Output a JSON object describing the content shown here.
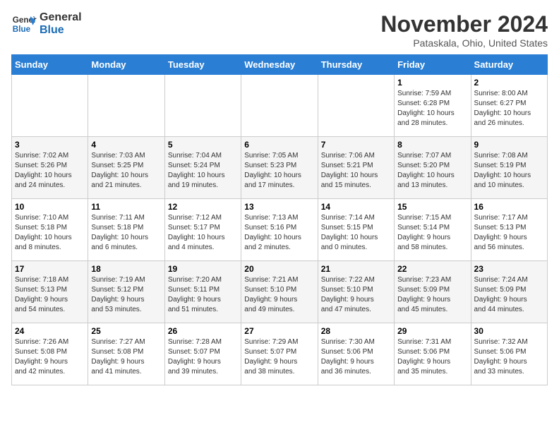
{
  "header": {
    "logo_line1": "General",
    "logo_line2": "Blue",
    "month_title": "November 2024",
    "location": "Pataskala, Ohio, United States"
  },
  "weekdays": [
    "Sunday",
    "Monday",
    "Tuesday",
    "Wednesday",
    "Thursday",
    "Friday",
    "Saturday"
  ],
  "weeks": [
    [
      {
        "day": "",
        "info": ""
      },
      {
        "day": "",
        "info": ""
      },
      {
        "day": "",
        "info": ""
      },
      {
        "day": "",
        "info": ""
      },
      {
        "day": "",
        "info": ""
      },
      {
        "day": "1",
        "info": "Sunrise: 7:59 AM\nSunset: 6:28 PM\nDaylight: 10 hours\nand 28 minutes."
      },
      {
        "day": "2",
        "info": "Sunrise: 8:00 AM\nSunset: 6:27 PM\nDaylight: 10 hours\nand 26 minutes."
      }
    ],
    [
      {
        "day": "3",
        "info": "Sunrise: 7:02 AM\nSunset: 5:26 PM\nDaylight: 10 hours\nand 24 minutes."
      },
      {
        "day": "4",
        "info": "Sunrise: 7:03 AM\nSunset: 5:25 PM\nDaylight: 10 hours\nand 21 minutes."
      },
      {
        "day": "5",
        "info": "Sunrise: 7:04 AM\nSunset: 5:24 PM\nDaylight: 10 hours\nand 19 minutes."
      },
      {
        "day": "6",
        "info": "Sunrise: 7:05 AM\nSunset: 5:23 PM\nDaylight: 10 hours\nand 17 minutes."
      },
      {
        "day": "7",
        "info": "Sunrise: 7:06 AM\nSunset: 5:21 PM\nDaylight: 10 hours\nand 15 minutes."
      },
      {
        "day": "8",
        "info": "Sunrise: 7:07 AM\nSunset: 5:20 PM\nDaylight: 10 hours\nand 13 minutes."
      },
      {
        "day": "9",
        "info": "Sunrise: 7:08 AM\nSunset: 5:19 PM\nDaylight: 10 hours\nand 10 minutes."
      }
    ],
    [
      {
        "day": "10",
        "info": "Sunrise: 7:10 AM\nSunset: 5:18 PM\nDaylight: 10 hours\nand 8 minutes."
      },
      {
        "day": "11",
        "info": "Sunrise: 7:11 AM\nSunset: 5:18 PM\nDaylight: 10 hours\nand 6 minutes."
      },
      {
        "day": "12",
        "info": "Sunrise: 7:12 AM\nSunset: 5:17 PM\nDaylight: 10 hours\nand 4 minutes."
      },
      {
        "day": "13",
        "info": "Sunrise: 7:13 AM\nSunset: 5:16 PM\nDaylight: 10 hours\nand 2 minutes."
      },
      {
        "day": "14",
        "info": "Sunrise: 7:14 AM\nSunset: 5:15 PM\nDaylight: 10 hours\nand 0 minutes."
      },
      {
        "day": "15",
        "info": "Sunrise: 7:15 AM\nSunset: 5:14 PM\nDaylight: 9 hours\nand 58 minutes."
      },
      {
        "day": "16",
        "info": "Sunrise: 7:17 AM\nSunset: 5:13 PM\nDaylight: 9 hours\nand 56 minutes."
      }
    ],
    [
      {
        "day": "17",
        "info": "Sunrise: 7:18 AM\nSunset: 5:13 PM\nDaylight: 9 hours\nand 54 minutes."
      },
      {
        "day": "18",
        "info": "Sunrise: 7:19 AM\nSunset: 5:12 PM\nDaylight: 9 hours\nand 53 minutes."
      },
      {
        "day": "19",
        "info": "Sunrise: 7:20 AM\nSunset: 5:11 PM\nDaylight: 9 hours\nand 51 minutes."
      },
      {
        "day": "20",
        "info": "Sunrise: 7:21 AM\nSunset: 5:10 PM\nDaylight: 9 hours\nand 49 minutes."
      },
      {
        "day": "21",
        "info": "Sunrise: 7:22 AM\nSunset: 5:10 PM\nDaylight: 9 hours\nand 47 minutes."
      },
      {
        "day": "22",
        "info": "Sunrise: 7:23 AM\nSunset: 5:09 PM\nDaylight: 9 hours\nand 45 minutes."
      },
      {
        "day": "23",
        "info": "Sunrise: 7:24 AM\nSunset: 5:09 PM\nDaylight: 9 hours\nand 44 minutes."
      }
    ],
    [
      {
        "day": "24",
        "info": "Sunrise: 7:26 AM\nSunset: 5:08 PM\nDaylight: 9 hours\nand 42 minutes."
      },
      {
        "day": "25",
        "info": "Sunrise: 7:27 AM\nSunset: 5:08 PM\nDaylight: 9 hours\nand 41 minutes."
      },
      {
        "day": "26",
        "info": "Sunrise: 7:28 AM\nSunset: 5:07 PM\nDaylight: 9 hours\nand 39 minutes."
      },
      {
        "day": "27",
        "info": "Sunrise: 7:29 AM\nSunset: 5:07 PM\nDaylight: 9 hours\nand 38 minutes."
      },
      {
        "day": "28",
        "info": "Sunrise: 7:30 AM\nSunset: 5:06 PM\nDaylight: 9 hours\nand 36 minutes."
      },
      {
        "day": "29",
        "info": "Sunrise: 7:31 AM\nSunset: 5:06 PM\nDaylight: 9 hours\nand 35 minutes."
      },
      {
        "day": "30",
        "info": "Sunrise: 7:32 AM\nSunset: 5:06 PM\nDaylight: 9 hours\nand 33 minutes."
      }
    ]
  ]
}
